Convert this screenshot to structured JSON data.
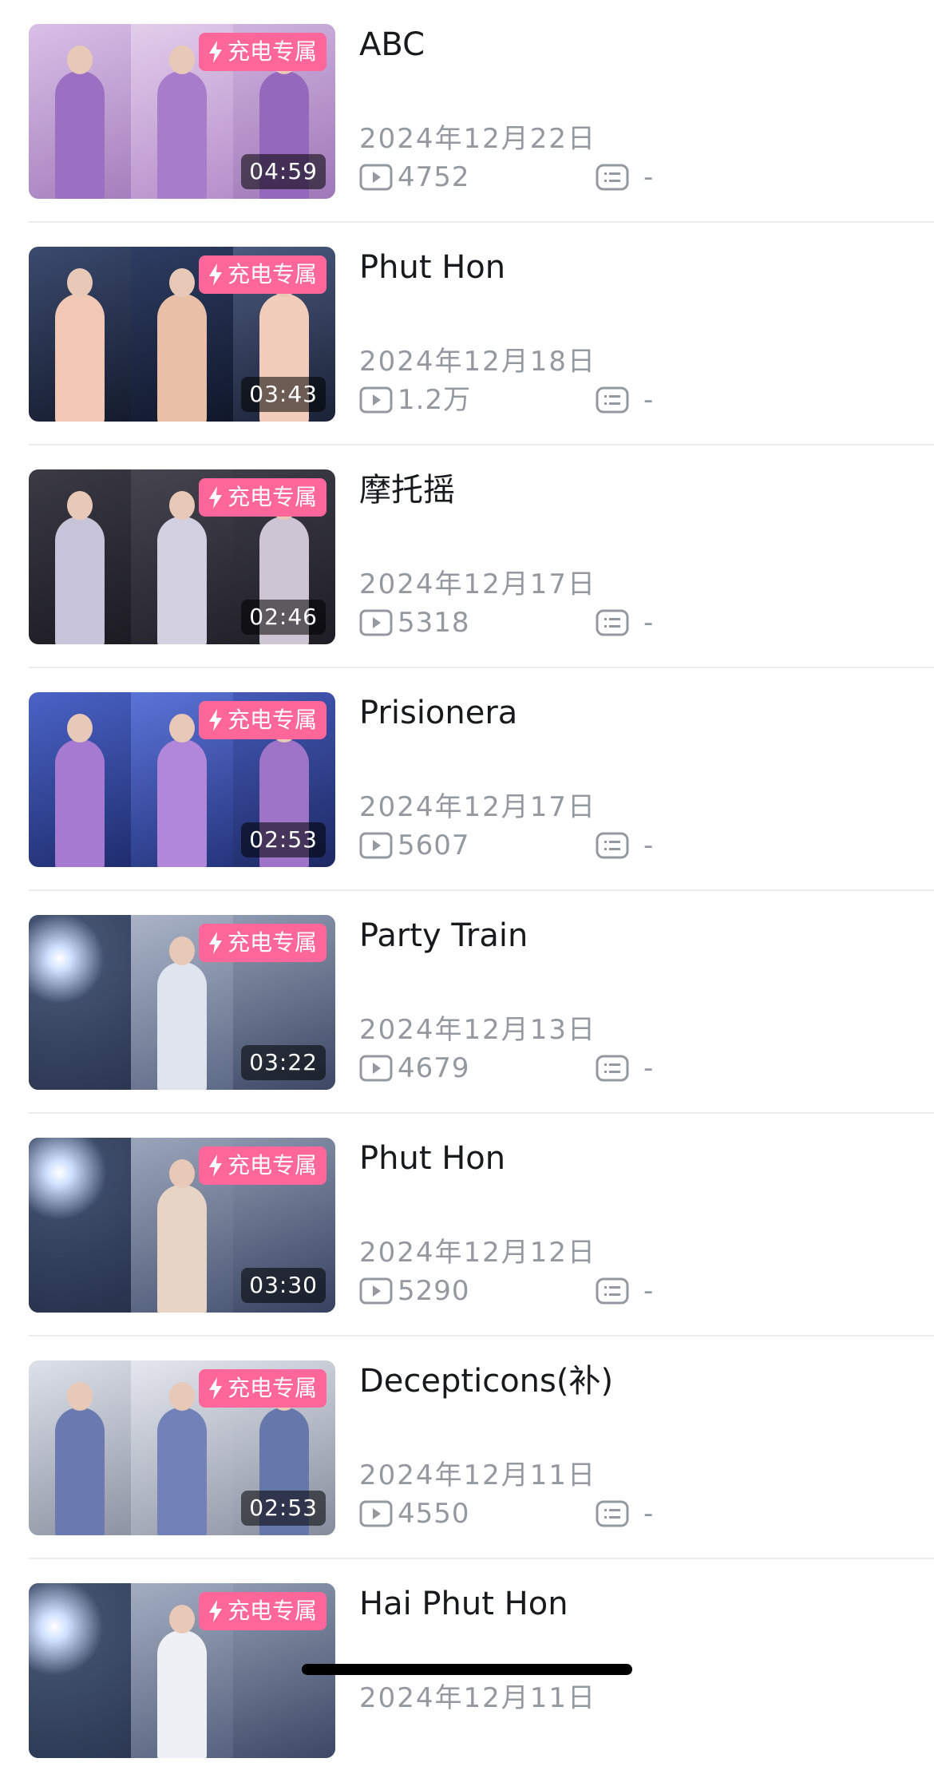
{
  "badge_label": "充电专属",
  "videos": [
    {
      "title": "ABC",
      "date": "2024年12月22日",
      "plays": "4752",
      "comments": "-",
      "duration": "04:59",
      "thumb": {
        "bg": [
          "#b58cc8",
          "#c9a0d6",
          "#a57fbd"
        ],
        "fig": "#9b6fc2"
      }
    },
    {
      "title": "Phut Hon",
      "date": "2024年12月18日",
      "plays": "1.2万",
      "comments": "-",
      "duration": "03:43",
      "thumb": {
        "bg": [
          "#2b3550",
          "#1d2740",
          "#3a4766"
        ],
        "fig": "#f0c8b4"
      }
    },
    {
      "title": "摩托摇",
      "date": "2024年12月17日",
      "plays": "5318",
      "comments": "-",
      "duration": "02:46",
      "thumb": {
        "bg": [
          "#2a2a33",
          "#34323d",
          "#2c2b34"
        ],
        "fig": "#c7c4d9"
      }
    },
    {
      "title": "Prisionera",
      "date": "2024年12月17日",
      "plays": "5607",
      "comments": "-",
      "duration": "02:53",
      "thumb": {
        "bg": [
          "#2e3f88",
          "#3b4fa8",
          "#2a3c80"
        ],
        "fig": "#a57ad0"
      }
    },
    {
      "title": "Party Train",
      "date": "2024年12月13日",
      "plays": "4679",
      "comments": "-",
      "duration": "03:22",
      "thumb": {
        "bg": [
          "#3a4a66",
          "#7d8aa3",
          "#5b6882"
        ],
        "fig": "#dfe4ef"
      }
    },
    {
      "title": "Phut Hon",
      "date": "2024年12月12日",
      "plays": "5290",
      "comments": "-",
      "duration": "03:30",
      "thumb": {
        "bg": [
          "#2f3d58",
          "#6d7a92",
          "#4b5872"
        ],
        "fig": "#e8d4c4"
      }
    },
    {
      "title": "Decepticons(补)",
      "date": "2024年12月11日",
      "plays": "4550",
      "comments": "-",
      "duration": "02:53",
      "thumb": {
        "bg": [
          "#c6cbd6",
          "#d2d6df",
          "#bfc4cf"
        ],
        "fig": "#6a7ab0"
      }
    },
    {
      "title": "Hai Phut Hon",
      "date": "2024年12月11日",
      "plays": "",
      "comments": "",
      "duration": "",
      "thumb": {
        "bg": [
          "#3a4a66",
          "#8a97b0",
          "#6b7890"
        ],
        "fig": "#eef0f5"
      }
    }
  ],
  "colors": {
    "badge": "#ff6699",
    "title_text": "#18191c",
    "meta_text": "#9499a0",
    "separator": "#ececec"
  },
  "icons": {
    "badge": "lightning-icon",
    "plays": "play-count-icon",
    "comments": "comment-list-icon"
  }
}
